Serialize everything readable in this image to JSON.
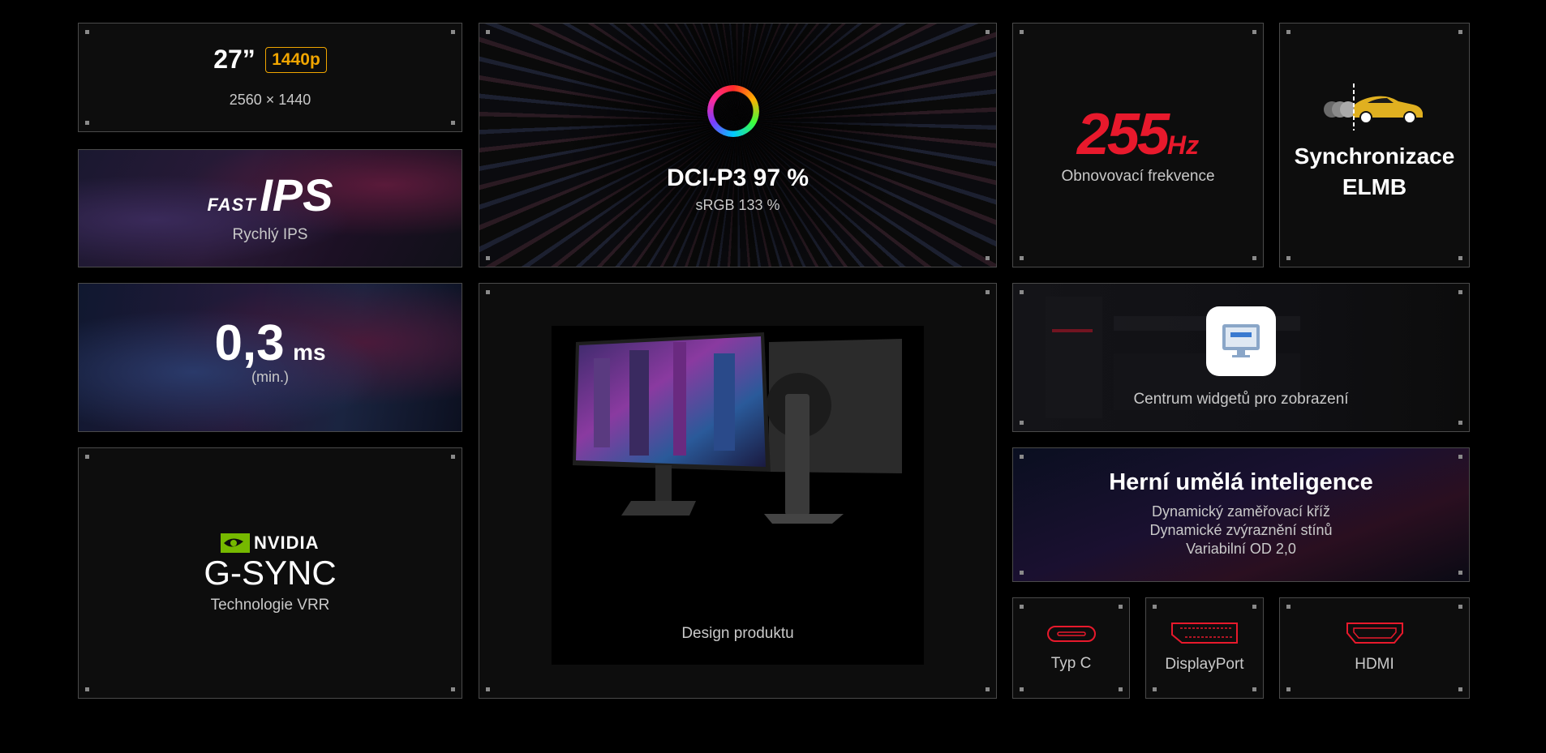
{
  "tiles": {
    "resolution": {
      "size": "27”",
      "badge": "1440p",
      "pixels": "2560 × 1440"
    },
    "ips": {
      "logo_fast": "FAST",
      "logo_ips": "IPS",
      "label": "Rychlý IPS"
    },
    "dci": {
      "title": "DCI-P3 97 %",
      "subtitle": "sRGB 133 %"
    },
    "refresh": {
      "value": "255",
      "unit": "Hz",
      "label": "Obnovovací frekvence"
    },
    "elmb": {
      "line1": "Synchronizace",
      "line2": "ELMB"
    },
    "response": {
      "value": "0,3",
      "unit": "ms",
      "note": "(min.)"
    },
    "design": {
      "label": "Design produktu"
    },
    "widget": {
      "label": "Centrum widgetů pro zobrazení"
    },
    "gsync": {
      "brand": "NVIDIA",
      "title": "G-SYNC",
      "label": "Technologie VRR"
    },
    "ai": {
      "title": "Herní umělá inteligence",
      "items": [
        "Dynamický zaměřovací kříž",
        "Dynamické zvýraznění stínů",
        "Variabilní OD 2,0"
      ]
    },
    "ports": [
      {
        "label": "Typ C"
      },
      {
        "label": "DisplayPort"
      },
      {
        "label": "HDMI"
      }
    ]
  },
  "colors": {
    "accent_red": "#e8192c",
    "badge_orange": "#f0a500",
    "tile_border": "#4a4a4a"
  },
  "icons": [
    "colour-ring-icon",
    "car-motion-icon",
    "nvidia-eye-icon",
    "widget-app-icon",
    "usb-c-port-icon",
    "displayport-port-icon",
    "hdmi-port-icon"
  ]
}
